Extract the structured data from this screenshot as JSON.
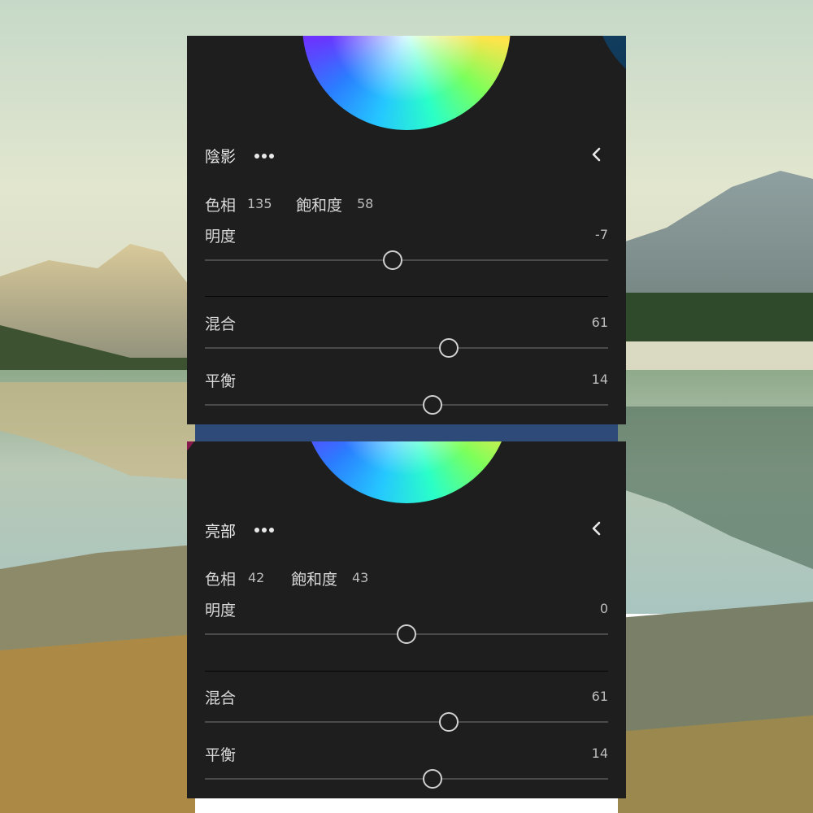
{
  "panels": {
    "shadows": {
      "title": "陰影",
      "hue_label": "色相",
      "hue_value": "135",
      "saturation_label": "飽和度",
      "saturation_value": "58",
      "luminance_label": "明度",
      "luminance_value": "-7",
      "blending_label": "混合",
      "blending_value": "61",
      "balance_label": "平衡",
      "balance_value": "14",
      "luminance_slider_fraction": 0.465,
      "blending_slider_fraction": 0.605,
      "balance_slider_fraction": 0.565
    },
    "highlights": {
      "title": "亮部",
      "hue_label": "色相",
      "hue_value": "42",
      "saturation_label": "飽和度",
      "saturation_value": "43",
      "luminance_label": "明度",
      "luminance_value": "0",
      "blending_label": "混合",
      "blending_value": "61",
      "balance_label": "平衡",
      "balance_value": "14",
      "luminance_slider_fraction": 0.5,
      "blending_slider_fraction": 0.605,
      "balance_slider_fraction": 0.565
    }
  },
  "icons": {
    "more": "more-dots-icon",
    "collapse": "chevron-left-icon"
  },
  "colors": {
    "panel_background": "#1e1e1e",
    "text": "#e2e2e2",
    "slider_track": "#4a4a4a",
    "slider_thumb": "#d0d0d0"
  }
}
